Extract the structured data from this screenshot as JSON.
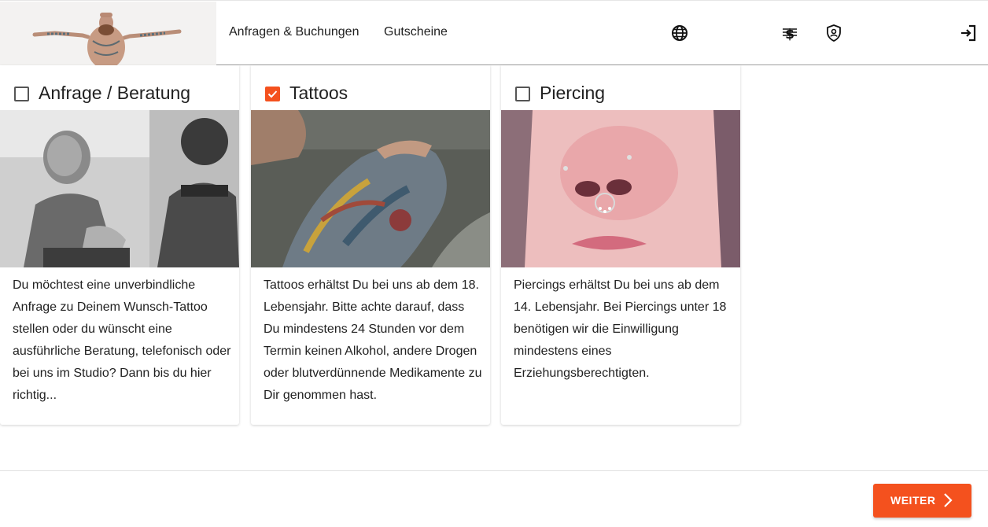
{
  "header": {
    "nav": [
      {
        "label": "Anfragen & Buchungen"
      },
      {
        "label": "Gutscheine"
      }
    ],
    "icons": [
      "globe-icon",
      "currency-icon",
      "privacy-shield-icon",
      "login-icon"
    ]
  },
  "cards": [
    {
      "title": "Anfrage / Beratung",
      "checked": false,
      "text": "Du möchtest eine unverbindliche Anfrage zu Deinem Wunsch-Tattoo stellen oder du wünscht eine ausführliche Beratung, telefonisch oder bei uns im Studio? Dann bis du hier richtig..."
    },
    {
      "title": "Tattoos",
      "checked": true,
      "text": "Tattoos erhältst Du bei uns ab dem 18. Lebensjahr. Bitte achte darauf, dass Du mindestens 24 Stunden vor dem Termin keinen Alkohol, andere Drogen oder blutverdünnende Medikamente zu Dir genommen hast."
    },
    {
      "title": "Piercing",
      "checked": false,
      "text": "Piercings erhältst Du bei uns ab dem 14. Lebensjahr. Bei Piercings unter 18 benötigen wir die Einwilligung mindestens eines Erziehungsberechtigten."
    }
  ],
  "footer": {
    "next_label": "WEITER"
  },
  "colors": {
    "accent": "#f4511e"
  }
}
